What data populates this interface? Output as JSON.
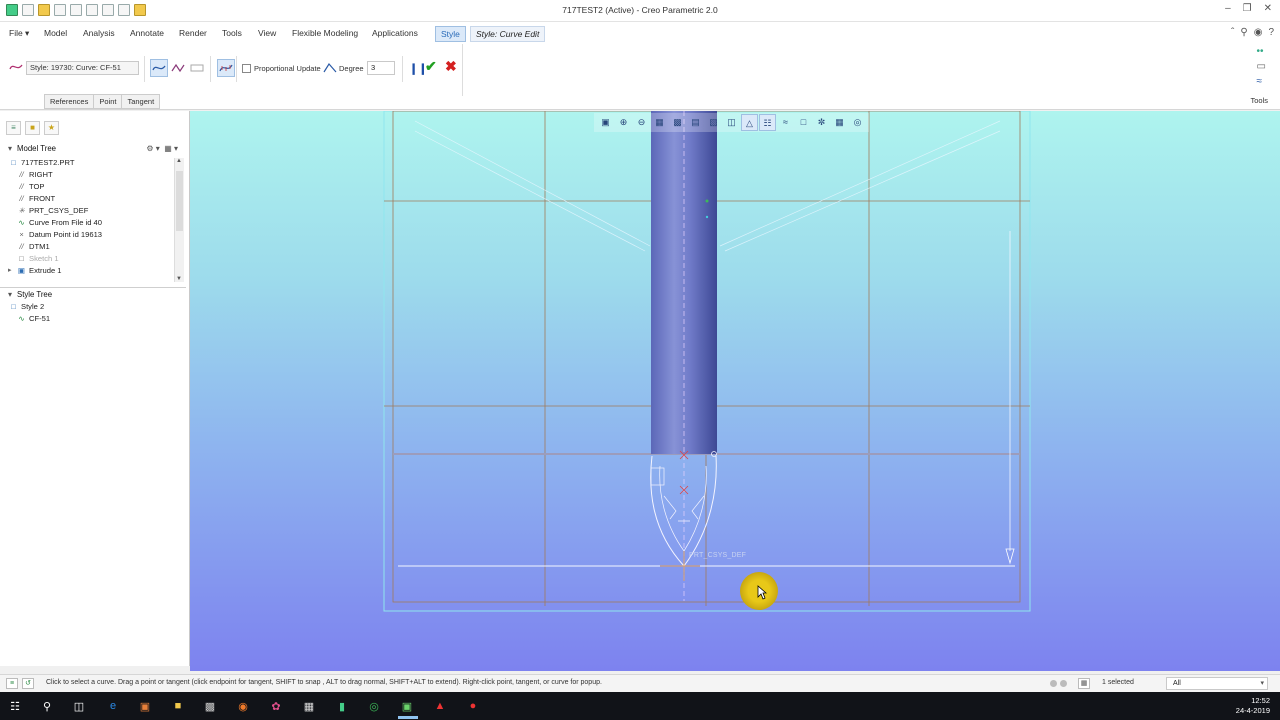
{
  "window": {
    "title": "717TEST2 (Active) - Creo Parametric 2.0"
  },
  "tabs": [
    {
      "label": "File ▾"
    },
    {
      "label": "Model"
    },
    {
      "label": "Analysis"
    },
    {
      "label": "Annotate"
    },
    {
      "label": "Render"
    },
    {
      "label": "Tools"
    },
    {
      "label": "View"
    },
    {
      "label": "Flexible Modeling"
    },
    {
      "label": "Applications"
    },
    {
      "label": "Style"
    },
    {
      "label": "Style: Curve Edit"
    }
  ],
  "dashboard": {
    "style_field": "Style: 19730: Curve:  CF-51",
    "proportional_update_label": "Proportional Update",
    "proportional_update_checked": false,
    "degree_label": "Degree",
    "degree_value": "3",
    "subtabs": [
      "References",
      "Point",
      "Tangent"
    ],
    "tools_label": "Tools",
    "icons": [
      "curve-icon",
      "free-curve-icon",
      "planar-curve-icon",
      "cos-curve-icon",
      "curvature-icon",
      "degree-icon",
      "pause-icon",
      "ok-check-icon",
      "cancel-x-icon"
    ]
  },
  "model_tree": {
    "header": "Model Tree",
    "items": [
      {
        "label": "717TEST2.PRT",
        "icon": "part-icon",
        "dim": false,
        "expandable": false
      },
      {
        "label": "RIGHT",
        "icon": "datum-plane-icon",
        "dim": false,
        "expandable": false
      },
      {
        "label": "TOP",
        "icon": "datum-plane-icon",
        "dim": false,
        "expandable": false
      },
      {
        "label": "FRONT",
        "icon": "datum-plane-icon",
        "dim": false,
        "expandable": false
      },
      {
        "label": "PRT_CSYS_DEF",
        "icon": "csys-icon",
        "dim": false,
        "expandable": false
      },
      {
        "label": "Curve From File id 40",
        "icon": "curve-from-file-icon",
        "dim": false,
        "expandable": false
      },
      {
        "label": "Datum Point id 19613",
        "icon": "datum-point-icon",
        "dim": false,
        "expandable": false
      },
      {
        "label": "DTM1",
        "icon": "datum-plane-icon",
        "dim": false,
        "expandable": false
      },
      {
        "label": "Sketch 1",
        "icon": "sketch-icon",
        "dim": true,
        "expandable": false
      },
      {
        "label": "Extrude 1",
        "icon": "extrude-icon",
        "dim": false,
        "expandable": true
      }
    ]
  },
  "style_tree": {
    "header": "Style Tree",
    "items": [
      {
        "label": "Style 2",
        "icon": "style-feature-icon"
      },
      {
        "label": "CF-51",
        "icon": "style-curve-icon"
      }
    ]
  },
  "viewport": {
    "csys_label": "PRT_CSYS_DEF",
    "toolbar": [
      "refit-icon",
      "zoom-in-icon",
      "zoom-out-icon",
      "repaint-icon",
      "saved-views-icon",
      "display-style-icon",
      "view-manager-icon",
      "perspective-icon",
      "datum-display-icon",
      "style-point-display-icon",
      "curvature-display-icon",
      "section-icon",
      "spin-center-icon",
      "annotation-display-icon",
      "shade-icon"
    ]
  },
  "statusbar": {
    "message": "Click to select a curve.  Drag a point or tangent (click endpoint for tangent, SHIFT to snap , ALT to drag normal, SHIFT+ALT to extend). Right-click point, tangent, or curve for popup.",
    "selected": "1 selected",
    "filter": "All"
  },
  "taskbar": {
    "time": "12:52",
    "date": "24-4-2019"
  },
  "colors": {
    "viewport_top": "#aef4ee",
    "viewport_bottom": "#7d82ef",
    "accent": "#2a6bb8",
    "ok": "#22a022",
    "cancel": "#d42020"
  }
}
